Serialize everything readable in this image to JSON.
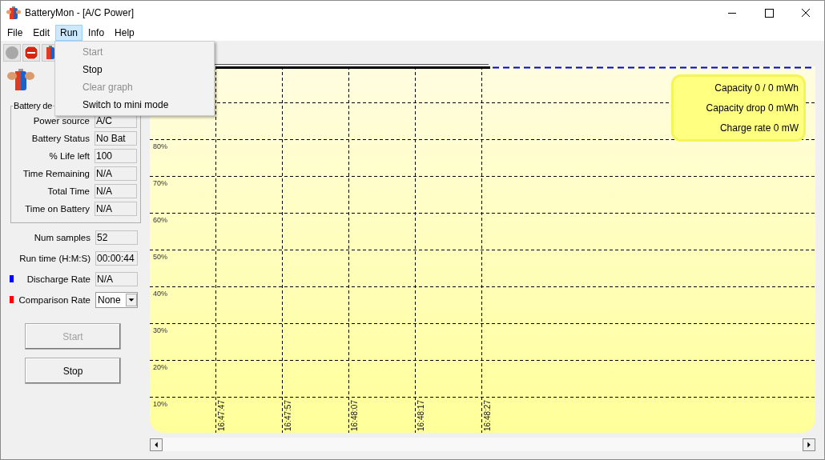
{
  "window": {
    "title": "BatteryMon - [A/C Power]"
  },
  "menu": [
    {
      "label": "File",
      "selected": false
    },
    {
      "label": "Edit",
      "selected": false
    },
    {
      "label": "Run",
      "selected": true
    },
    {
      "label": "Info",
      "selected": false
    },
    {
      "label": "Help",
      "selected": false
    }
  ],
  "run_menu": [
    {
      "label": "Start",
      "disabled": true
    },
    {
      "label": "Stop",
      "disabled": false
    },
    {
      "label": "Clear graph",
      "disabled": true
    },
    {
      "label": "Switch to mini mode",
      "disabled": false
    }
  ],
  "battery_details": {
    "title": "Battery de",
    "fields": [
      {
        "label": "Power source",
        "value": "A/C"
      },
      {
        "label": "Battery Status",
        "value": "No Bat"
      },
      {
        "label": "% Life left",
        "value": "100"
      },
      {
        "label": "Time Remaining",
        "value": "N/A"
      },
      {
        "label": "Total Time",
        "value": "N/A"
      },
      {
        "label": "Time on Battery",
        "value": "N/A"
      }
    ]
  },
  "stats": [
    {
      "label": "Num samples",
      "value": "52"
    },
    {
      "label": "Run time (H:M:S)",
      "value": "00:00:44"
    },
    {
      "label": "Discharge Rate",
      "value": "N/A",
      "color": "#0000ff"
    }
  ],
  "comparison": {
    "label": "Comparison Rate",
    "value": "None",
    "color": "#ff0000"
  },
  "buttons": [
    {
      "label": "Start",
      "disabled": true
    },
    {
      "label": "Stop",
      "disabled": false
    }
  ],
  "graph": {
    "y_labels": [
      "80%",
      "70%",
      "60%",
      "50%",
      "40%",
      "30%",
      "20%",
      "10%"
    ],
    "x_labels": [
      "16:47:47",
      "16:47:57",
      "16:48:07",
      "16:48:17",
      "16:48:27"
    ],
    "info": [
      "Capacity 0 / 0 mWh",
      "Capacity drop 0 mWh",
      "Charge rate 0 mW"
    ]
  }
}
